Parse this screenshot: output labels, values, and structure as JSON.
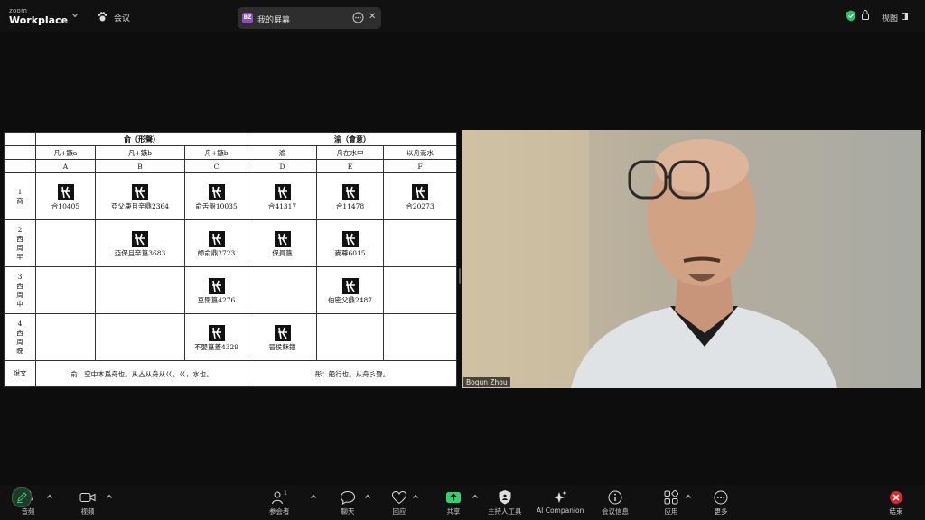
{
  "app": {
    "brand_top": "zoom",
    "brand_bottom": "Workplace"
  },
  "topbar": {
    "meeting_label": "会议",
    "share_pill": {
      "avatar": "BZ",
      "label": "我的屏幕"
    },
    "view_label": "视图"
  },
  "shared_table": {
    "groups": [
      "俞（形聲）",
      "渝（會意）"
    ],
    "subheaders": [
      "凡+鏃a",
      "凡+鏃b",
      "舟+鏃b",
      "渝",
      "舟在水中",
      "以舟涎水"
    ],
    "letters": [
      "A",
      "B",
      "C",
      "D",
      "E",
      "F"
    ],
    "rows": [
      {
        "num": "1",
        "period": "商",
        "cells": [
          "合10405",
          "亞父庚且辛鼎2364",
          "俞舌盤10035",
          "合41317",
          "合11478",
          "合20273"
        ]
      },
      {
        "num": "2",
        "period": "西周早",
        "cells": [
          "",
          "亞保且辛簋3683",
          "師俞鼎2723",
          "保員簋",
          "麥尊6015",
          ""
        ]
      },
      {
        "num": "3",
        "period": "西周中",
        "cells": [
          "",
          "",
          "豆閉簋4276",
          "",
          "伯密父鼎2487",
          ""
        ]
      },
      {
        "num": "4",
        "period": "西周晚",
        "cells": [
          "",
          "",
          "不嬰簋蓋4329",
          "晉侯穌鐘",
          "",
          ""
        ]
      }
    ],
    "shuowen_label": "說文",
    "shuowen_left": "俞：空中木爲舟也。从亼从舟从巜。巜，水也。",
    "shuowen_right": "彤：船行也。从舟彡聲。"
  },
  "video": {
    "participant_name": "Boqun Zhou"
  },
  "toolbar": {
    "audio": "音频",
    "video": "视频",
    "participants": "参会者",
    "participants_count": "1",
    "chat": "聊天",
    "react": "回应",
    "share": "共享",
    "host_tools": "主持人工具",
    "ai_companion": "AI Companion",
    "meeting_info": "会议信息",
    "apps": "应用",
    "more": "更多",
    "end": "结束"
  },
  "colors": {
    "share_green": "#2dd46b",
    "end_red": "#e0262b",
    "shield_green": "#26c46a"
  }
}
